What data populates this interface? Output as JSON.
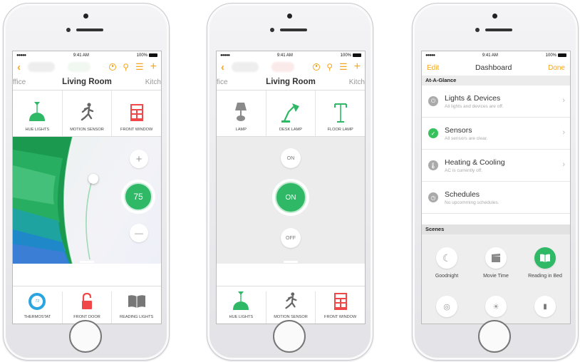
{
  "status": {
    "signal": "●●●●● ",
    "time": "9:41 AM",
    "battery": "100%"
  },
  "colors": {
    "accent": "#f5a623",
    "green": "#37c25e",
    "red": "#f04848"
  },
  "phone1": {
    "rooms": {
      "left": "ffice",
      "current": "Living Room",
      "right": "Kitch"
    },
    "devices": [
      {
        "label": "HUE LIGHTS",
        "icon": "pendant-lamp-icon"
      },
      {
        "label": "MOTION SENSOR",
        "icon": "walking-person-icon"
      },
      {
        "label": "FRONT WINDOW",
        "icon": "window-icon"
      }
    ],
    "controls": {
      "plus": "+",
      "value": "75",
      "minus": "—"
    },
    "bottom_devices": [
      {
        "label": "THERMOSTAT",
        "icon": "thermostat-icon",
        "badge": "72"
      },
      {
        "label": "FRONT DOOR",
        "icon": "unlocked-icon"
      },
      {
        "label": "READING LIGHTS",
        "icon": "book-icon"
      }
    ]
  },
  "phone2": {
    "rooms": {
      "left": "fice",
      "current": "Living Room",
      "right": "Kitch"
    },
    "devices": [
      {
        "label": "LAMP",
        "icon": "table-lamp-icon"
      },
      {
        "label": "DESK LAMP",
        "icon": "desk-lamp-icon"
      },
      {
        "label": "FLOOR LAMP",
        "icon": "floor-lamp-icon"
      }
    ],
    "buttons": {
      "on_top": "ON",
      "on_main": "ON",
      "off": "OFF"
    },
    "bottom_devices": [
      {
        "label": "HUE LIGHTS",
        "icon": "pendant-lamp-icon"
      },
      {
        "label": "MOTION SENSOR",
        "icon": "walking-person-icon"
      },
      {
        "label": "FRONT WINDOW",
        "icon": "window-icon"
      }
    ]
  },
  "phone3": {
    "nav": {
      "edit": "Edit",
      "title": "Dashboard",
      "done": "Done"
    },
    "glance_header": "At-A-Glance",
    "glance": [
      {
        "title": "Lights & Devices",
        "subtitle": "All lights and devices are off.",
        "icon": "power-icon"
      },
      {
        "title": "Sensors",
        "subtitle": "All sensors are clear.",
        "icon": "check-icon"
      },
      {
        "title": "Heating & Cooling",
        "subtitle": "AC is currently off.",
        "icon": "thermometer-icon"
      },
      {
        "title": "Schedules",
        "subtitle": "No upcomming schedules.",
        "icon": "clock-icon"
      }
    ],
    "scenes_header": "Scenes",
    "scenes": [
      {
        "label": "Goodnight",
        "icon": "moon-icon"
      },
      {
        "label": "Movie Time",
        "icon": "clapperboard-icon"
      },
      {
        "label": "Reading in Bed",
        "icon": "book-icon"
      }
    ]
  }
}
